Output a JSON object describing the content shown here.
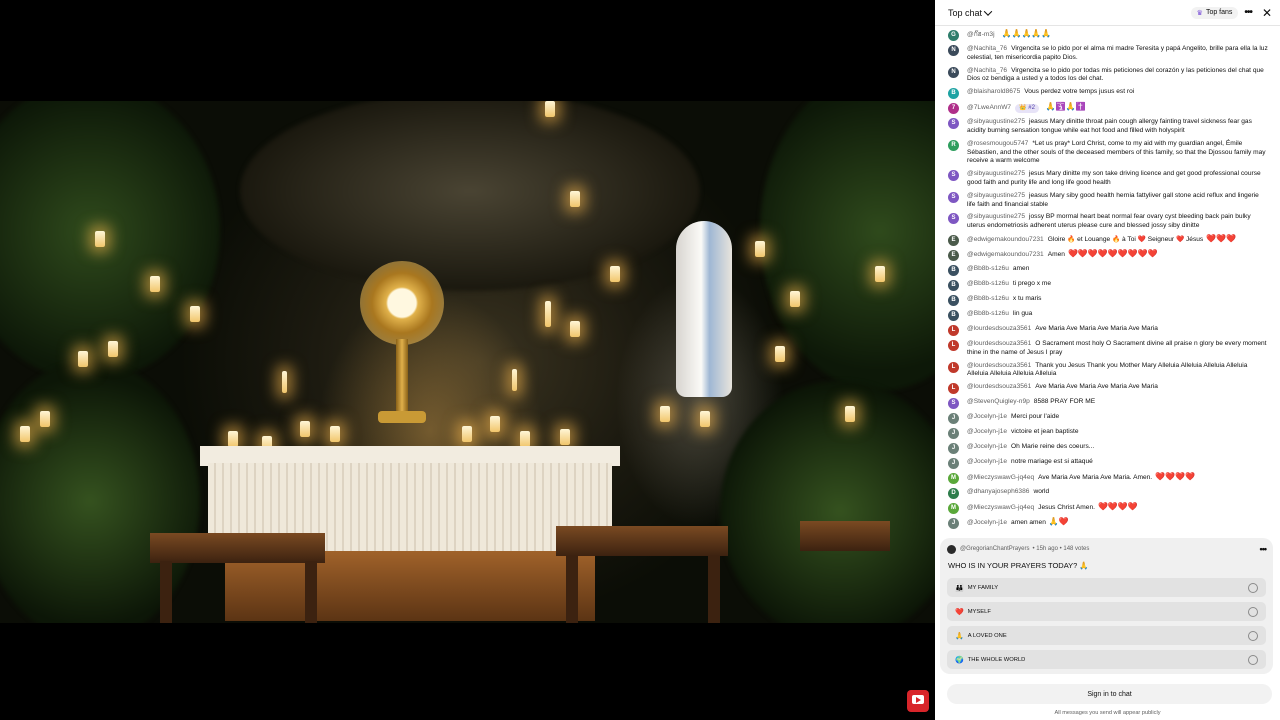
{
  "chat": {
    "title": "Top chat",
    "top_fans_label": "Top fans",
    "messages": [
      {
        "initial": "G",
        "avatar_color": "#2e7d6b",
        "author": "@ก๊ฮ-m3j",
        "text": "",
        "emoji": "🙏🙏🙏🙏🙏"
      },
      {
        "initial": "N",
        "avatar_color": "#3b4a5a",
        "author": "@Nachita_76",
        "text": "Virgencita se lo pido por el alma mi madre Teresita y papá Angelito, brille para ella la luz celestial, ten misericordia papito Dios.",
        "emoji": ""
      },
      {
        "initial": "N",
        "avatar_color": "#3b4a5a",
        "author": "@Nachita_76",
        "text": "Virgencita se lo pido por todas mis peticiones del corazón y las peticiones del chat que Dios oz bendiga a usted y a todos los del chat.",
        "emoji": ""
      },
      {
        "initial": "B",
        "avatar_color": "#1ea3a3",
        "author": "@blaisharold8675",
        "text": "Vous perdez votre temps jusus est roi",
        "emoji": ""
      },
      {
        "initial": "7",
        "avatar_color": "#b02f8a",
        "author": "@7LweAnnW7",
        "badge": "👑 #2",
        "text": "",
        "emoji": "🙏🛐🙏✝️"
      },
      {
        "initial": "S",
        "avatar_color": "#7e57c2",
        "author": "@sibyaugustine275",
        "text": "jeasus Mary dinitte throat pain cough allergy fainting travel sickness fear gas acidity burning sensation tongue while eat hot food and filled with holyspirit",
        "emoji": ""
      },
      {
        "initial": "R",
        "avatar_color": "#2e9e5e",
        "author": "@rosesmougou5747",
        "text": "*Let us pray* Lord Christ, come to my aid with my guardian angel, Émile Sébastien, and the other souls of the deceased members of this family, so that the Djossou family may receive a warm welcome",
        "emoji": ""
      },
      {
        "initial": "S",
        "avatar_color": "#7e57c2",
        "author": "@sibyaugustine275",
        "text": "jesus Mary dinitte my son take driving licence and get good professional course good faith and purity life and long life good health",
        "emoji": ""
      },
      {
        "initial": "S",
        "avatar_color": "#7e57c2",
        "author": "@sibyaugustine275",
        "text": "jeasus Mary siby good health hernia fattyliver gall stone acid reflux and lingerie life faith and financial stable",
        "emoji": ""
      },
      {
        "initial": "S",
        "avatar_color": "#7e57c2",
        "author": "@sibyaugustine275",
        "text": "jossy BP mormal heart beat normal fear ovary cyst bleeding back pain bulky uterus endometriosis adherent uterus please cure and blessed jossy siby dinitte",
        "emoji": ""
      },
      {
        "initial": "E",
        "avatar_color": "#4a5a4a",
        "author": "@edwigemakoundou7231",
        "text": "Gloire 🔥 et Louange 🔥 à Toi ❤️ Seigneur ❤️ Jésus",
        "emoji": "❤️❤️❤️"
      },
      {
        "initial": "E",
        "avatar_color": "#4a5a4a",
        "author": "@edwigemakoundou7231",
        "text": "Amen",
        "emoji": "❤️❤️❤️❤️❤️❤️❤️❤️❤️"
      },
      {
        "initial": "B",
        "avatar_color": "#3a5060",
        "author": "@Bb8b-s1z6u",
        "text": "amen",
        "emoji": ""
      },
      {
        "initial": "B",
        "avatar_color": "#3a5060",
        "author": "@Bb8b-s1z6u",
        "text": "ti prego x me",
        "emoji": ""
      },
      {
        "initial": "B",
        "avatar_color": "#3a5060",
        "author": "@Bb8b-s1z6u",
        "text": "x tu maris",
        "emoji": ""
      },
      {
        "initial": "B",
        "avatar_color": "#3a5060",
        "author": "@Bb8b-s1z6u",
        "text": "lin gua",
        "emoji": ""
      },
      {
        "initial": "L",
        "avatar_color": "#c0392b",
        "author": "@lourdesdsouza3561",
        "text": "Ave Maria Ave Maria Ave Maria Ave Maria",
        "emoji": ""
      },
      {
        "initial": "L",
        "avatar_color": "#c0392b",
        "author": "@lourdesdsouza3561",
        "text": "O Sacrament most holy O Sacrament divine all praise n glory be every moment thine in the name of Jesus I pray",
        "emoji": ""
      },
      {
        "initial": "L",
        "avatar_color": "#c0392b",
        "author": "@lourdesdsouza3561",
        "text": "Thank you Jesus Thank you Mother Mary Alleluia Alleluia Alleluia Alleluia Alleluia Alleluia Alleluia Alleluia",
        "emoji": ""
      },
      {
        "initial": "L",
        "avatar_color": "#c0392b",
        "author": "@lourdesdsouza3561",
        "text": "Ave Maria Ave Maria Ave Maria Ave Maria",
        "emoji": ""
      },
      {
        "initial": "S",
        "avatar_color": "#7e57c2",
        "author": "@StevenQuigley-n9p",
        "text": "8588 PRAY FOR ME",
        "emoji": ""
      },
      {
        "initial": "J",
        "avatar_color": "#6b8078",
        "author": "@Jocelyn-j1e",
        "text": "Merci pour l'aide",
        "emoji": ""
      },
      {
        "initial": "J",
        "avatar_color": "#6b8078",
        "author": "@Jocelyn-j1e",
        "text": "victoire et jean baptiste",
        "emoji": ""
      },
      {
        "initial": "J",
        "avatar_color": "#6b8078",
        "author": "@Jocelyn-j1e",
        "text": "Oh Marie reine des coeurs...",
        "emoji": ""
      },
      {
        "initial": "J",
        "avatar_color": "#6b8078",
        "author": "@Jocelyn-j1e",
        "text": "notre mariage est si attaqué",
        "emoji": ""
      },
      {
        "initial": "M",
        "avatar_color": "#5aa83a",
        "author": "@MieczyswawG-jq4eq",
        "text": "Ave Maria Ave Maria Ave Maria. Amen.",
        "emoji": "❤️❤️❤️❤️"
      },
      {
        "initial": "D",
        "avatar_color": "#2e7d4b",
        "author": "@dhanyajoseph6386",
        "text": "world",
        "emoji": ""
      },
      {
        "initial": "M",
        "avatar_color": "#5aa83a",
        "author": "@MieczyswawG-jq4eq",
        "text": "Jesus Christ Amen.",
        "emoji": "❤️❤️❤️❤️"
      },
      {
        "initial": "J",
        "avatar_color": "#6b8078",
        "author": "@Jocelyn-j1e",
        "text": "amen amen",
        "emoji": "🙏❤️"
      }
    ],
    "poll": {
      "author": "@GregorianChantPrayers",
      "meta": "• 15h ago • 148 votes",
      "question": "WHO IS IN YOUR PRAYERS TODAY? 🙏",
      "options": [
        {
          "emoji": "👪",
          "label": "MY FAMILY"
        },
        {
          "emoji": "❤️",
          "label": "MYSELF"
        },
        {
          "emoji": "🙏",
          "label": "A LOVED ONE"
        },
        {
          "emoji": "🌍",
          "label": "THE WHOLE WORLD"
        }
      ]
    },
    "signin_label": "Sign in to chat",
    "footer_note": "All messages you send will appear publicly"
  },
  "icons": {
    "more": "more-vert-icon",
    "close": "close-icon",
    "chevron": "chevron-down-icon",
    "crown": "crown-icon",
    "youtube": "youtube-logo-icon"
  },
  "colors": {
    "chat_bg": "#ffffff",
    "poll_bg": "#f0f0f0",
    "youtube_red": "#d8252a"
  }
}
